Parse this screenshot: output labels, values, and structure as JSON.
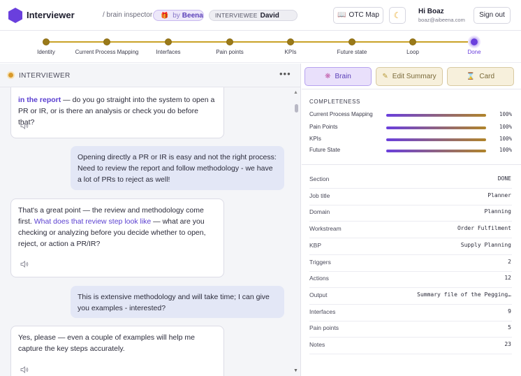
{
  "header": {
    "app_title": "Interviewer",
    "breadcrumb": "/ brain inspector",
    "by_prefix": "by",
    "by_name": "Beena",
    "interviewee_label": "INTERVIEWEE",
    "interviewee_name": "David",
    "otc_map_label": "OTC Map",
    "greeting": "Hi Boaz",
    "email": "boaz@aibeena.com",
    "sign_out_label": "Sign out"
  },
  "steps": [
    {
      "label": "Identity",
      "state": "done"
    },
    {
      "label": "Current Process Mapping",
      "state": "done"
    },
    {
      "label": "Interfaces",
      "state": "done"
    },
    {
      "label": "Pain points",
      "state": "done"
    },
    {
      "label": "KPIs",
      "state": "done"
    },
    {
      "label": "Future state",
      "state": "done"
    },
    {
      "label": "Loop",
      "state": "done"
    },
    {
      "label": "Done",
      "state": "current"
    }
  ],
  "chat": {
    "title": "INTERVIEWER",
    "messages": [
      {
        "role": "bot",
        "highlight": "in the report",
        "text": " — do you go straight into the system to open a PR or IR, or is there an analysis or check you do before that?"
      },
      {
        "role": "user",
        "text": "Opening directly a PR or IR is easy and not the right process: Need to review the report and follow methodology - we have a lot of PRs to reject as well!"
      },
      {
        "role": "bot",
        "text_before": "That's a great point — the review and methodology come first. ",
        "highlight": "What does that review step look like",
        "text_after": " — what are you checking or analyzing before you decide whether to open, reject, or action a PR/IR?"
      },
      {
        "role": "user",
        "text": "This is extensive methodology and will take time; I can give you examples - interested?"
      },
      {
        "role": "bot",
        "text": "Yes, please — even a couple of examples will help me capture the key steps accurately."
      }
    ]
  },
  "tabs": {
    "brain": "Brain",
    "edit_summary": "Edit Summary",
    "card": "Card"
  },
  "completeness": {
    "title": "COMPLETENESS",
    "rows": [
      {
        "label": "Current Process Mapping",
        "value": "100%",
        "fraction": 1.0
      },
      {
        "label": "Pain Points",
        "value": "100%",
        "fraction": 1.0
      },
      {
        "label": "KPIs",
        "value": "100%",
        "fraction": 1.0
      },
      {
        "label": "Future State",
        "value": "100%",
        "fraction": 1.0
      }
    ]
  },
  "details": [
    {
      "key": "Section",
      "value": "DONE"
    },
    {
      "key": "Job title",
      "value": "Planner"
    },
    {
      "key": "Domain",
      "value": "Planning"
    },
    {
      "key": "Workstream",
      "value": "Order Fulfilment"
    },
    {
      "key": "KBP",
      "value": "Supply Planning"
    },
    {
      "key": "Triggers",
      "value": "2"
    },
    {
      "key": "Actions",
      "value": "12"
    },
    {
      "key": "Output",
      "value": "Summary file of the Pegging…"
    },
    {
      "key": "Interfaces",
      "value": "9"
    },
    {
      "key": "Pain points",
      "value": "5"
    },
    {
      "key": "Notes",
      "value": "23"
    }
  ],
  "colors": {
    "accent_purple": "#6a3fdd",
    "step_gold": "#c9a227",
    "live_dot": "#d99a2b"
  }
}
